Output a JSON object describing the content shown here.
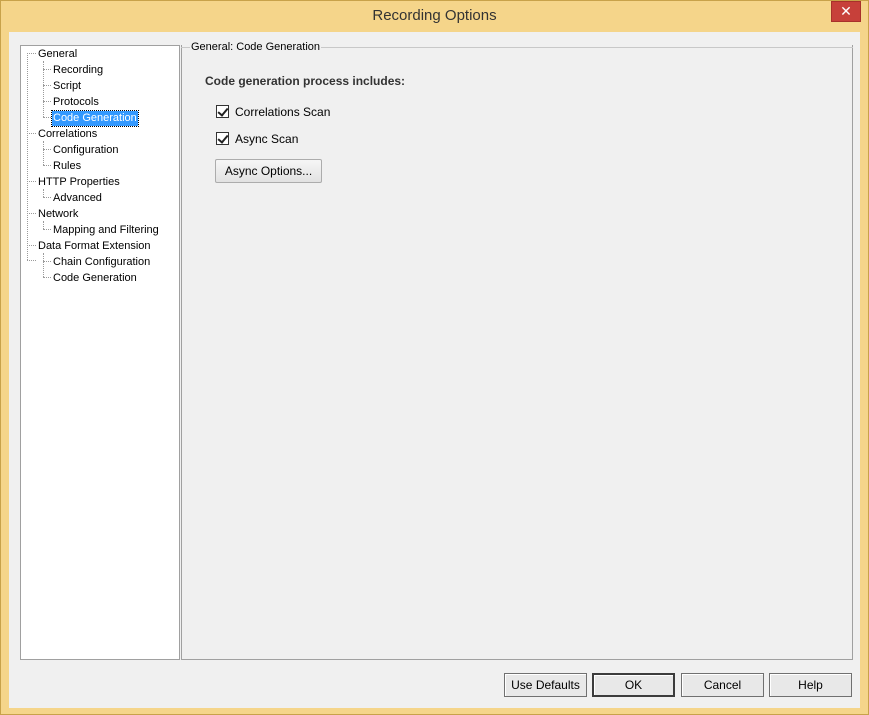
{
  "window": {
    "title": "Recording Options",
    "close_glyph": "✕"
  },
  "tree": {
    "items": [
      {
        "label": "General"
      },
      {
        "label": "Recording"
      },
      {
        "label": "Script"
      },
      {
        "label": "Protocols"
      },
      {
        "label": "Code Generation"
      },
      {
        "label": "Correlations"
      },
      {
        "label": "Configuration"
      },
      {
        "label": "Rules"
      },
      {
        "label": "HTTP Properties"
      },
      {
        "label": "Advanced"
      },
      {
        "label": "Network"
      },
      {
        "label": "Mapping and Filtering"
      },
      {
        "label": "Data Format Extension"
      },
      {
        "label": "Chain Configuration"
      },
      {
        "label": "Code Generation"
      }
    ],
    "selected": "General / Code Generation"
  },
  "panel": {
    "group_title": "General: Code Generation",
    "heading": "Code generation process includes:",
    "checkboxes": [
      {
        "label": "Correlations Scan",
        "checked": true
      },
      {
        "label": "Async Scan",
        "checked": true
      }
    ],
    "async_options_label": "Async Options..."
  },
  "buttons": {
    "use_defaults": "Use Defaults",
    "ok": "OK",
    "cancel": "Cancel",
    "help": "Help"
  },
  "colors": {
    "frame": "#f5d58a",
    "selection": "#3399ff",
    "close": "#c7403a"
  }
}
